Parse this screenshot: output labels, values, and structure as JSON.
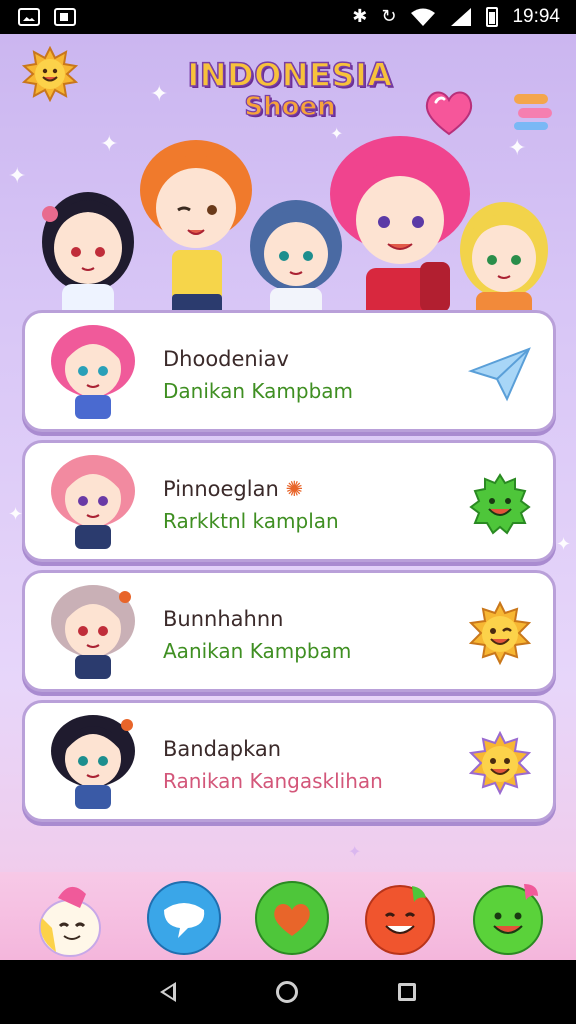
{
  "status_bar": {
    "time": "19:94"
  },
  "header": {
    "title_line1": "INDONESIA",
    "title_line2": "Shoen"
  },
  "cards": [
    {
      "name": "Dhoodeniav",
      "subtitle": "Danikan Kampbam",
      "subtitle_color": "#3f8f22",
      "action_icon": "paper-plane-icon"
    },
    {
      "name": "Pinnoeglan",
      "subtitle": "Rarkktnl kamplan",
      "subtitle_color": "#3f8f22",
      "action_icon": "green-slime-icon"
    },
    {
      "name": "Bunnhahnn",
      "subtitle": "Aanikan Kampbam",
      "subtitle_color": "#3f8f22",
      "action_icon": "winking-sun-icon"
    },
    {
      "name": "Bandapkan",
      "subtitle": "Ranikan Kangasklihan",
      "subtitle_color": "#d3577a",
      "action_icon": "smiling-sun-icon"
    }
  ],
  "dock": [
    {
      "icon": "mascot-icon"
    },
    {
      "icon": "chat-bubble-icon"
    },
    {
      "icon": "green-heart-icon"
    },
    {
      "icon": "tomato-face-icon"
    },
    {
      "icon": "green-face-icon"
    }
  ],
  "colors": {
    "background_top": "#cbb6f0",
    "background_bottom": "#f4c8e6",
    "card_border": "#b9a0d9",
    "title_fill": "#f7c23b",
    "title_outline": "#7a3fa6",
    "subtitle_green": "#3f8f22",
    "subtitle_pink": "#d3577a"
  }
}
